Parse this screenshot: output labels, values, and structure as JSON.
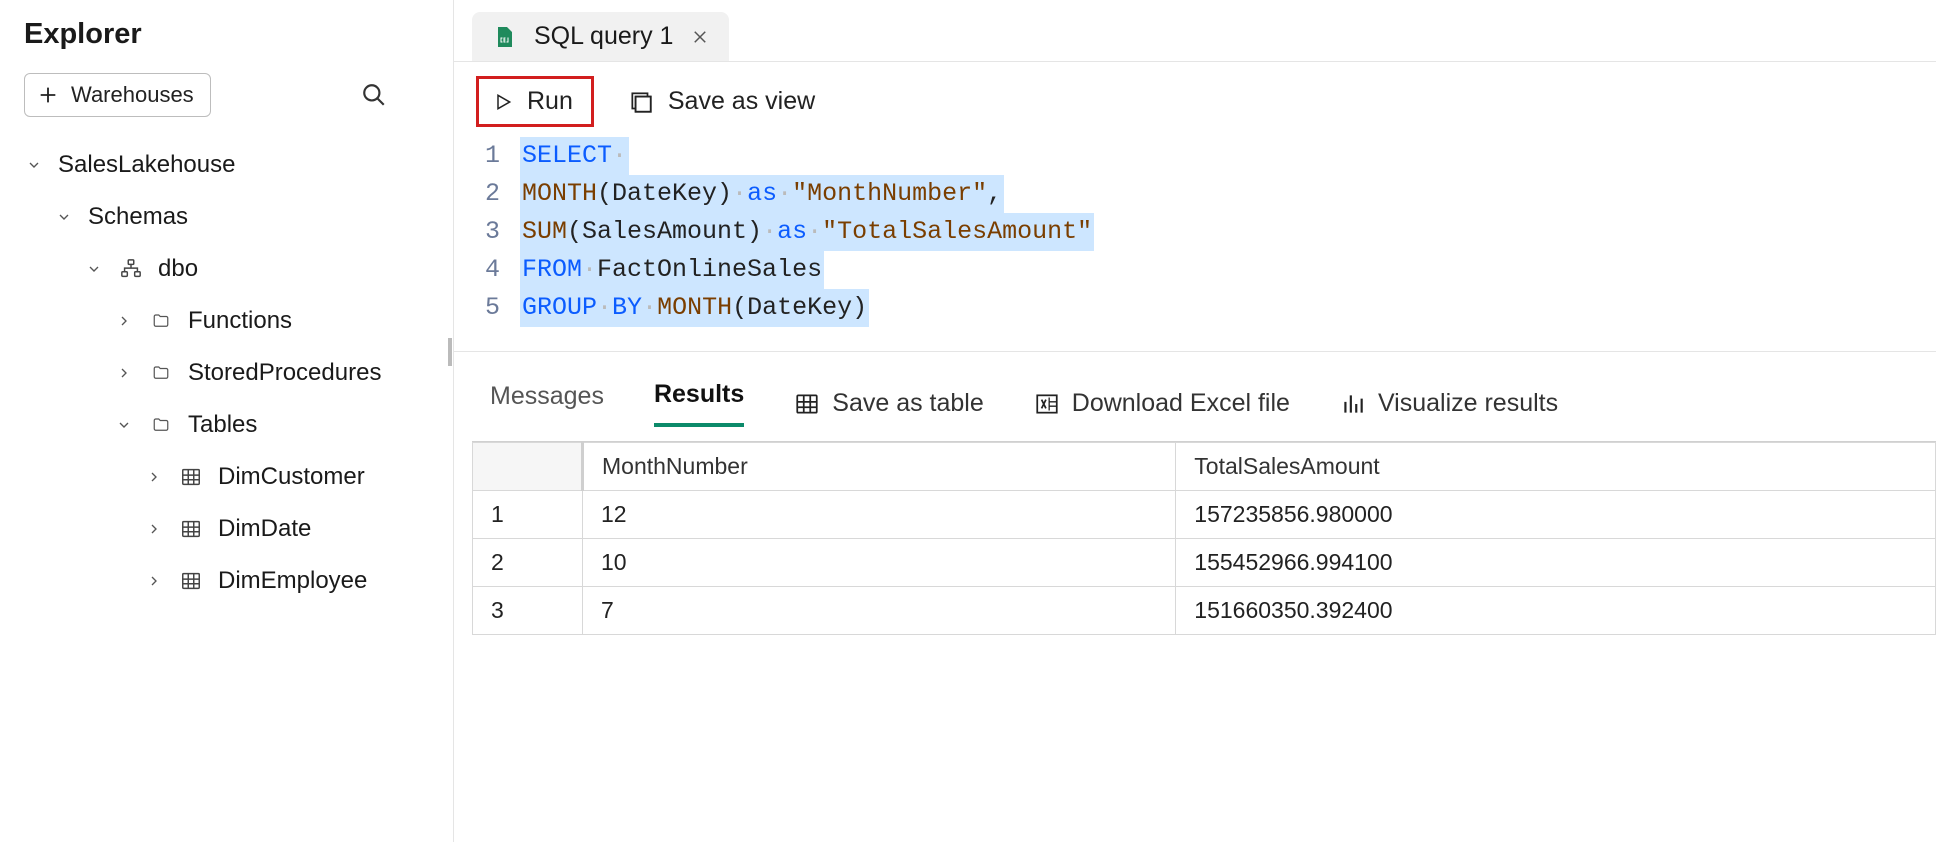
{
  "sidebar": {
    "title": "Explorer",
    "warehouses_btn": "Warehouses",
    "tree": {
      "root": "SalesLakehouse",
      "schemas_label": "Schemas",
      "dbo_label": "dbo",
      "functions_label": "Functions",
      "stored_label": "StoredProcedures",
      "tables_label": "Tables",
      "tables": [
        {
          "label": "DimCustomer"
        },
        {
          "label": "DimDate"
        },
        {
          "label": "DimEmployee"
        }
      ]
    }
  },
  "tab": {
    "label": "SQL query 1"
  },
  "toolbar": {
    "run_label": "Run",
    "save_view_label": "Save as view"
  },
  "sql": {
    "lines": [
      "1",
      "2",
      "3",
      "4",
      "5"
    ],
    "l1": {
      "select": "SELECT"
    },
    "l2": {
      "month": "MONTH",
      "open": "(DateKey)",
      "as": "as",
      "alias": "\"MonthNumber\"",
      "comma": ","
    },
    "l3": {
      "sum": "SUM",
      "open": "(SalesAmount)",
      "as": "as",
      "alias": "\"TotalSalesAmount\""
    },
    "l4": {
      "from": "FROM",
      "tbl": "FactOnlineSales"
    },
    "l5": {
      "group": "GROUP",
      "by": "BY",
      "month": "MONTH",
      "open": "(DateKey)"
    }
  },
  "results": {
    "messages_tab": "Messages",
    "results_tab": "Results",
    "save_table": "Save as table",
    "download_excel": "Download Excel file",
    "visualize": "Visualize results",
    "columns": {
      "c1": "MonthNumber",
      "c2": "TotalSalesAmount"
    },
    "rows": [
      {
        "n": "1",
        "c1": "12",
        "c2": "157235856.980000"
      },
      {
        "n": "2",
        "c1": "10",
        "c2": "155452966.994100"
      },
      {
        "n": "3",
        "c1": "7",
        "c2": "151660350.392400"
      }
    ]
  }
}
